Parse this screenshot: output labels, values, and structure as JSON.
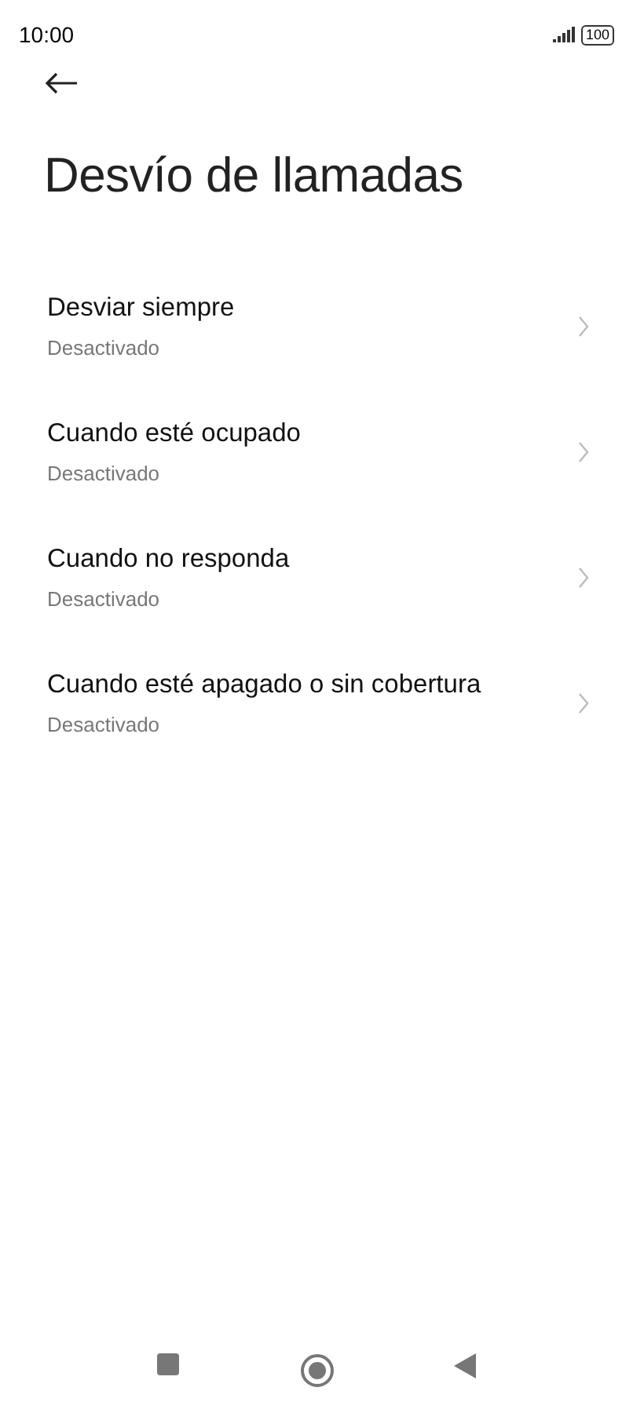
{
  "status_bar": {
    "time": "10:00",
    "battery": "100"
  },
  "title": "Desvío de llamadas",
  "items": [
    {
      "label": "Desviar siempre",
      "status": "Desactivado"
    },
    {
      "label": "Cuando esté ocupado",
      "status": "Desactivado"
    },
    {
      "label": "Cuando no responda",
      "status": "Desactivado"
    },
    {
      "label": "Cuando esté apagado o sin cobertura",
      "status": "Desactivado"
    }
  ]
}
